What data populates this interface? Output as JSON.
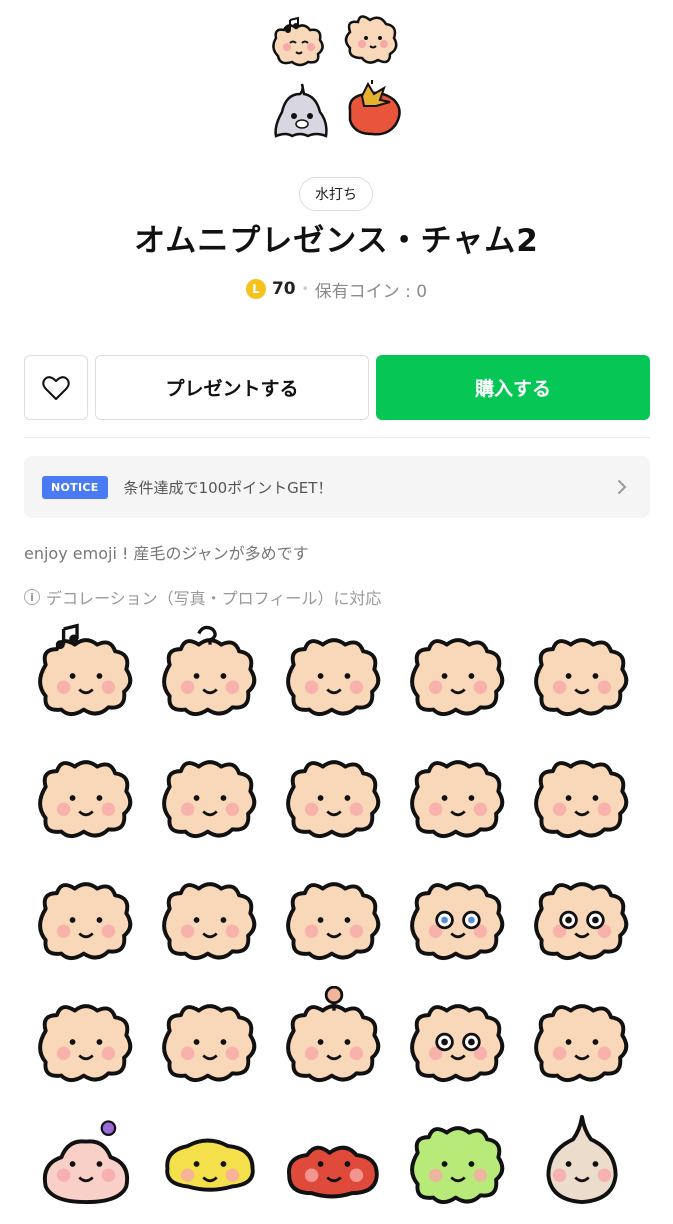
{
  "header": {
    "author": "水打ち",
    "title": "オムニプレゼンス・チャム2",
    "coin_symbol": "L",
    "price": "70",
    "separator": "•",
    "owned_coins": "保有コイン : 0"
  },
  "actions": {
    "favorite_icon": "heart-icon",
    "gift_label": "プレゼントする",
    "buy_label": "購入する"
  },
  "notice": {
    "badge": "NOTICE",
    "text": "条件達成で100ポイントGET！"
  },
  "description": "enjoy emoji ! 産毛のジャンが多めです",
  "decoration": {
    "info_icon": "i",
    "text": "デコレーション（写真・プロフィール）に対応"
  },
  "emojis": [
    "music-note-chum",
    "question-chum",
    "sleepy-chum",
    "tongue-chum",
    "blush-chum",
    "flat-chum",
    "crying-chum",
    "spotted-chum",
    "waving-chum",
    "surprised-chum",
    "angry-chum",
    "jumping-chum",
    "scared-chum",
    "blue-eyed-chum",
    "big-eyes-chum",
    "smug-chum",
    "happy-chum",
    "lollipop-chum",
    "round-eyes-chum",
    "side-eye-chum",
    "cupcake-chum",
    "yellow-blob-chum",
    "red-blob-chum",
    "green-chum",
    "onion-chum"
  ],
  "colors": {
    "accent_green": "#06c755",
    "notice_blue": "#4a7bf5",
    "coin_yellow": "#f5c21b",
    "fur": "#f8d8b8",
    "blush": "#f7a8a8"
  }
}
